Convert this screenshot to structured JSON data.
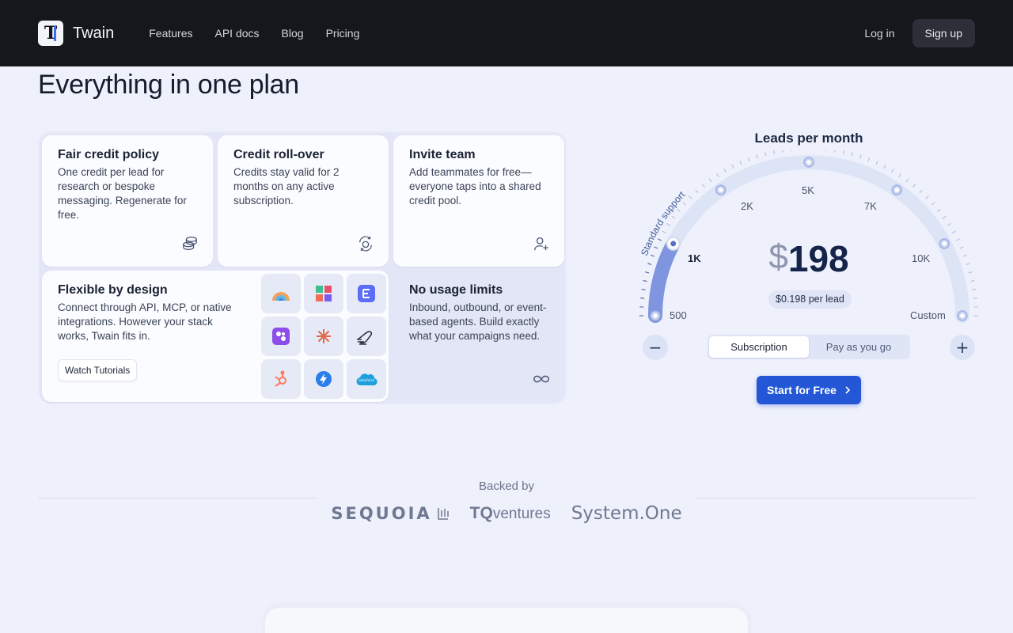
{
  "nav": {
    "brand": "Twain",
    "links": [
      "Features",
      "API docs",
      "Blog",
      "Pricing"
    ],
    "login": "Log in",
    "signup": "Sign up"
  },
  "page": {
    "title": "Everything in one plan"
  },
  "features": {
    "fair_credit": {
      "title": "Fair credit policy",
      "text": "One credit per lead for research or bespoke messaging. Regenerate for free."
    },
    "rollover": {
      "title": "Credit roll-over",
      "text": "Credits stay valid for 2 months on any active subscription."
    },
    "invite": {
      "title": "Invite team",
      "text": "Add teammates for free—everyone taps into a shared credit pool."
    },
    "flexible": {
      "title": "Flexible by design",
      "text": "Connect through API, MCP, or native integrations. However your stack works, Twain fits in.",
      "button": "Watch Tutorials"
    },
    "no_limits": {
      "title": "No usage limits",
      "text": "Inbound, outbound, or event-based agents. Build exactly what your campaigns need."
    }
  },
  "integrations": [
    "rainbow-icon",
    "grid-blocks-icon",
    "elementor-icon",
    "make-icon",
    "claude-icon",
    "wave-hand-icon",
    "hubspot-icon",
    "zapier-bolt-icon",
    "salesforce-icon"
  ],
  "integration_labels": {
    "salesforce": "salesforce"
  },
  "pricing": {
    "title": "Leads per month",
    "currency": "$",
    "amount": "198",
    "per_lead": "$0.198 per lead",
    "arc_label": "Standard support",
    "ticks": [
      "500",
      "1K",
      "2K",
      "5K",
      "7K",
      "10K",
      "Custom"
    ],
    "selected_tick": "1K",
    "toggle": [
      "Subscription",
      "Pay as you go"
    ],
    "active_toggle": "Subscription",
    "minus": "−",
    "plus": "+",
    "cta": "Start for Free"
  },
  "backers": {
    "label": "Backed by",
    "sequoia": "SEQUOIA",
    "tq_bold": "TQ",
    "tq_rest": "ventures",
    "system_one": "System.One"
  },
  "colors": {
    "accent": "#2357d6",
    "nav_bg": "#15171d",
    "page_bg": "#eef1fb",
    "gauge_fill": "#7f95e0"
  }
}
